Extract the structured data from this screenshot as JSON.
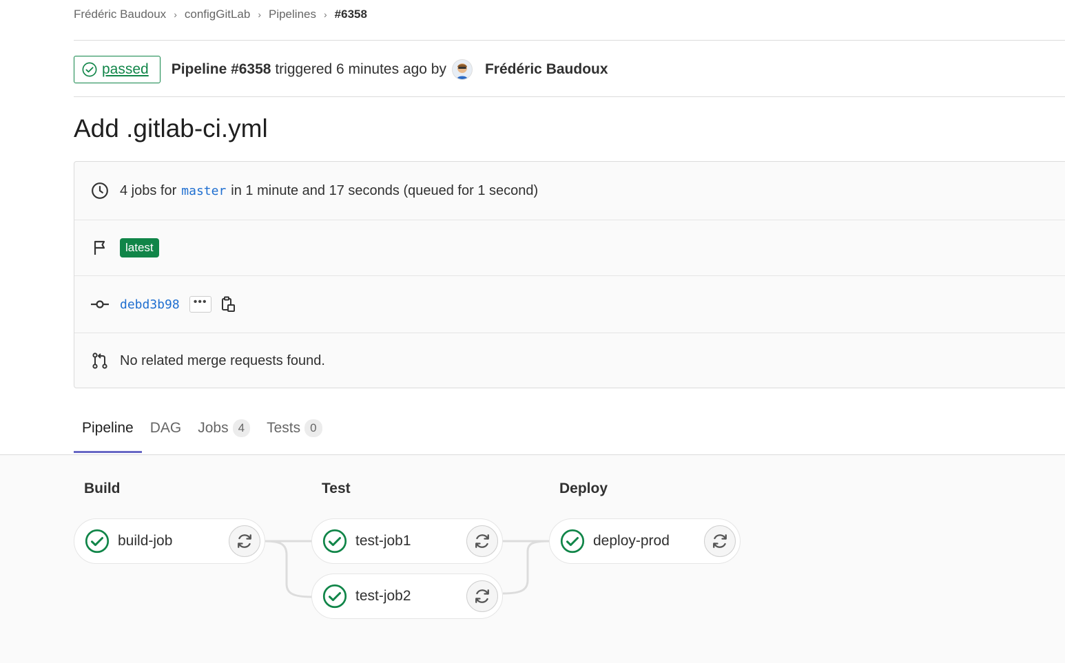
{
  "breadcrumb": {
    "items": [
      "Frédéric Baudoux",
      "configGitLab",
      "Pipelines"
    ],
    "current": "#6358"
  },
  "header": {
    "status": "passed",
    "pipeline_label": "Pipeline #6358",
    "triggered_text": "triggered 6 minutes ago by",
    "author": "Frédéric Baudoux"
  },
  "title": "Add .gitlab-ci.yml",
  "info": {
    "jobs_prefix": "4 jobs for",
    "branch": "master",
    "duration_text": "in 1 minute and 17 seconds (queued for 1 second)",
    "tag": "latest",
    "commit_sha": "debd3b98",
    "more_label": "•••",
    "merge_requests": "No related merge requests found."
  },
  "tabs": [
    {
      "label": "Pipeline"
    },
    {
      "label": "DAG"
    },
    {
      "label": "Jobs",
      "count": "4"
    },
    {
      "label": "Tests",
      "count": "0"
    }
  ],
  "stages": [
    {
      "name": "Build",
      "jobs": [
        "build-job"
      ]
    },
    {
      "name": "Test",
      "jobs": [
        "test-job1",
        "test-job2"
      ]
    },
    {
      "name": "Deploy",
      "jobs": [
        "deploy-prod"
      ]
    }
  ],
  "colors": {
    "success": "#108548",
    "link": "#1f6fd0",
    "tab_accent": "#6666c4"
  },
  "icons": {
    "status": "status-success-icon",
    "clock": "clock-icon",
    "flag": "flag-icon",
    "commit": "commit-icon",
    "copy": "copy-clipboard-icon",
    "merge_request": "merge-request-icon",
    "retry": "retry-icon"
  }
}
